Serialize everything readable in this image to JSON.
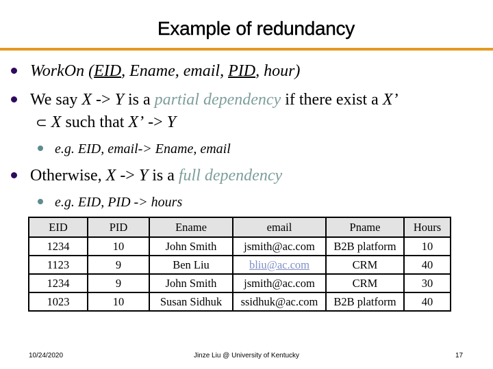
{
  "slide": {
    "title": "Example of redundancy",
    "accent_color": "#e39a21"
  },
  "bullets": {
    "b1": {
      "relation": "WorkOn",
      "open": " (",
      "key1": "EID",
      "sep1": ", Ename, email, ",
      "key2": "PID",
      "rest": ", hour)"
    },
    "b2": {
      "t1": "We say ",
      "x": "X",
      "arrow": " -> ",
      "y": "Y",
      "t2": " is a ",
      "term": "partial dependency",
      "t3": " if there exist a ",
      "xprime": "X’",
      "line2_subset": "⊂",
      "line2_x": "X",
      "line2_t": " such that ",
      "line2_xprime": "X’",
      "line2_arrow": " -> ",
      "line2_y": "Y"
    },
    "b2_sub": "e.g. EID, email-> Ename, email",
    "b3": {
      "t1": "Otherwise, ",
      "x": "X",
      "arrow": " -> ",
      "y": "Y",
      "t2": " is a ",
      "term": "full dependency"
    },
    "b3_sub": "e.g. EID, PID -> hours"
  },
  "table": {
    "headers": [
      "EID",
      "PID",
      "Ename",
      "email",
      "Pname",
      "Hours"
    ],
    "rows": [
      [
        "1234",
        "10",
        "John Smith",
        "jsmith@ac.com",
        "B2B platform",
        "10"
      ],
      [
        "1123",
        "9",
        "Ben Liu",
        "bliu@ac.com",
        "CRM",
        "40"
      ],
      [
        "1234",
        "9",
        "John Smith",
        "jsmith@ac.com",
        "CRM",
        "30"
      ],
      [
        "1023",
        "10",
        "Susan Sidhuk",
        "ssidhuk@ac.com",
        "B2B platform",
        "40"
      ]
    ]
  },
  "footer": {
    "date": "10/24/2020",
    "author": "Jinze Liu @ University of Kentucky",
    "page_number": "17"
  }
}
